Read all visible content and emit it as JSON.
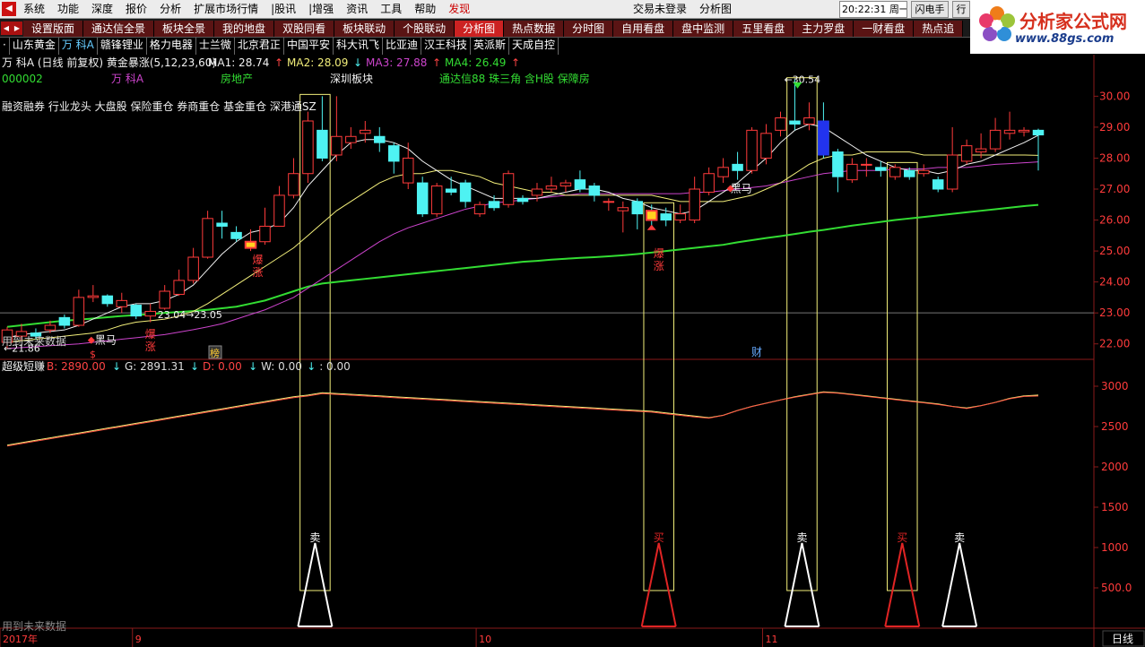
{
  "menu": {
    "items": [
      "系统",
      "功能",
      "深度",
      "报价",
      "分析",
      "扩展市场行情",
      "|股讯",
      "|增强",
      "资讯",
      "工具",
      "帮助",
      "发现"
    ],
    "hot_index": 11,
    "login": "交易未登录",
    "title": "分析图",
    "clock": "20:22:31 周一",
    "flash_button": "闪电手",
    "row_button": "行"
  },
  "logo": {
    "title": "分析家公式网",
    "url": "www.88gs.com"
  },
  "tabs": {
    "items": [
      "设置版面",
      "通达信全景",
      "板块全景",
      "我的地盘",
      "双股同看",
      "板块联动",
      "个股联动",
      "分析图",
      "热点数据",
      "分时图",
      "自用看盘",
      "盘中监测",
      "五里看盘",
      "主力罗盘",
      "一财看盘",
      "热点追"
    ],
    "active_index": 7
  },
  "stocks": {
    "items": [
      "·",
      "山东黄金",
      "万 科A",
      "赣锋锂业",
      "格力电器",
      "士兰微",
      "北京君正",
      "中国平安",
      "科大讯飞",
      "比亚迪",
      "汉王科技",
      "英派斯",
      "天成自控"
    ],
    "selected_index": 2
  },
  "colors": {
    "up": "#ff3b3b",
    "down": "#4ef2f2",
    "ma1": "#f2f2f2",
    "ma2": "#f2ee7a",
    "ma3": "#cc44cc",
    "ma4": "#33dd33",
    "box": "#f2ee7a",
    "b_line": "#ff5544",
    "g_line": "#f2ee7a"
  },
  "main_panel": {
    "title": "万 科A (日线 前复权) 黄金暴涨(5,12,23,60)",
    "ma_legend": [
      {
        "label": "MA1: 28.74",
        "arrow": "↑",
        "arrow_color": "#ff4444",
        "color": "#f2f2f2"
      },
      {
        "label": "MA2: 28.09",
        "arrow": "↓",
        "arrow_color": "#4ef2f2",
        "color": "#f2ee7a"
      },
      {
        "label": "MA3: 27.88",
        "arrow": "↑",
        "arrow_color": "#ff4444",
        "color": "#cc44cc"
      },
      {
        "label": "MA4: 26.49",
        "arrow": "↑",
        "arrow_color": "#ff4444",
        "color": "#33dd33"
      }
    ],
    "code": "000002",
    "name": "万 科A",
    "industry": "房地产",
    "board": "深圳板块",
    "concepts": "通达信88 珠三角 含H股 保障房",
    "tags": "融资融券 行业龙头 大盘股 保险重仓 券商重仓 基金重仓 深港通SZ",
    "future_data_note": "用到未来数据",
    "high_label": "30.54",
    "low_label": "21.86",
    "mid_label": "23.04→23.05",
    "markers": {
      "baozhang": "爆涨",
      "heima": "黑马",
      "s": "$",
      "bang": "榜",
      "cai": "财"
    },
    "y_ticks": [
      "30.00",
      "29.00",
      "28.00",
      "27.00",
      "26.00",
      "25.00",
      "24.00",
      "23.00",
      "22.00"
    ]
  },
  "sub_panel": {
    "title": "超级短赚",
    "legend": [
      {
        "label": "B: 2890.00",
        "arrow": "↓",
        "color": "#ff4444",
        "arrow_color": "#4ef2f2"
      },
      {
        "label": "G: 2891.31",
        "arrow": "↓",
        "color": "#dddddd",
        "arrow_color": "#4ef2f2"
      },
      {
        "label": "D: 0.00",
        "arrow": "↓",
        "color": "#ff4444",
        "arrow_color": "#4ef2f2"
      },
      {
        "label": "W: 0.00",
        "arrow": "↓",
        "color": "#dddddd",
        "arrow_color": "#4ef2f2"
      },
      {
        "label": ": 0.00",
        "arrow": "",
        "color": "#dddddd",
        "arrow_color": "#dddddd"
      }
    ],
    "future_data_note": "用到未来数据",
    "y_ticks": [
      "3000",
      "2500",
      "2000",
      "1500",
      "1000",
      "500.0"
    ],
    "sell_label": "卖",
    "buy_label": "买"
  },
  "x_axis": {
    "labels": [
      "2017年",
      "9",
      "10",
      "11"
    ],
    "period": "日线"
  },
  "chart_data": {
    "type": "candlestick",
    "ylim": [
      21.5,
      30.3
    ],
    "candles": [
      {
        "o": 22.05,
        "c": 22.45,
        "h": 22.55,
        "l": 21.86
      },
      {
        "o": 22.25,
        "c": 22.4,
        "h": 22.65,
        "l": 22.1
      },
      {
        "o": 22.35,
        "c": 22.25,
        "h": 22.5,
        "l": 22.15
      },
      {
        "o": 22.45,
        "c": 22.6,
        "h": 22.75,
        "l": 22.35
      },
      {
        "o": 22.85,
        "c": 22.6,
        "h": 22.95,
        "l": 22.5
      },
      {
        "o": 22.6,
        "c": 23.5,
        "h": 23.75,
        "l": 22.55
      },
      {
        "o": 23.5,
        "c": 23.55,
        "h": 23.9,
        "l": 23.35
      },
      {
        "o": 23.55,
        "c": 23.3,
        "h": 23.6,
        "l": 23.2
      },
      {
        "o": 23.2,
        "c": 23.4,
        "h": 23.65,
        "l": 23.0
      },
      {
        "o": 23.25,
        "c": 22.9,
        "h": 23.3,
        "l": 22.8
      },
      {
        "o": 22.9,
        "c": 23.05,
        "h": 23.3,
        "l": 22.7
      },
      {
        "o": 23.15,
        "c": 23.7,
        "h": 23.9,
        "l": 23.1
      },
      {
        "o": 23.6,
        "c": 24.05,
        "h": 24.4,
        "l": 23.55
      },
      {
        "o": 24.05,
        "c": 24.8,
        "h": 25.1,
        "l": 23.95
      },
      {
        "o": 24.8,
        "c": 26.05,
        "h": 26.3,
        "l": 24.75
      },
      {
        "o": 25.9,
        "c": 25.8,
        "h": 26.3,
        "l": 25.4
      },
      {
        "o": 25.6,
        "c": 25.4,
        "h": 25.8,
        "l": 25.3
      },
      {
        "o": 25.1,
        "c": 25.3,
        "h": 25.7,
        "l": 25.0
      },
      {
        "o": 25.3,
        "c": 25.8,
        "h": 26.4,
        "l": 25.2
      },
      {
        "o": 25.8,
        "c": 26.8,
        "h": 27.1,
        "l": 25.8
      },
      {
        "o": 26.8,
        "c": 27.5,
        "h": 28.0,
        "l": 26.7
      },
      {
        "o": 27.5,
        "c": 29.2,
        "h": 29.5,
        "l": 27.2
      },
      {
        "o": 28.9,
        "c": 28.0,
        "h": 30.0,
        "l": 27.9
      },
      {
        "o": 28.1,
        "c": 28.7,
        "h": 30.0,
        "l": 27.9
      },
      {
        "o": 28.5,
        "c": 28.7,
        "h": 29.0,
        "l": 28.3
      },
      {
        "o": 28.8,
        "c": 28.9,
        "h": 29.2,
        "l": 28.5
      },
      {
        "o": 28.7,
        "c": 28.5,
        "h": 29.0,
        "l": 28.2
      },
      {
        "o": 28.4,
        "c": 27.9,
        "h": 28.5,
        "l": 27.5
      },
      {
        "o": 27.2,
        "c": 28.0,
        "h": 28.5,
        "l": 27.0
      },
      {
        "o": 27.2,
        "c": 26.2,
        "h": 27.4,
        "l": 26.1
      },
      {
        "o": 26.2,
        "c": 27.1,
        "h": 27.2,
        "l": 26.1
      },
      {
        "o": 27.0,
        "c": 26.9,
        "h": 27.4,
        "l": 26.8
      },
      {
        "o": 27.2,
        "c": 26.6,
        "h": 27.3,
        "l": 26.4
      },
      {
        "o": 26.2,
        "c": 26.5,
        "h": 26.6,
        "l": 26.1
      },
      {
        "o": 26.6,
        "c": 26.4,
        "h": 26.8,
        "l": 26.3
      },
      {
        "o": 26.5,
        "c": 27.5,
        "h": 27.6,
        "l": 26.4
      },
      {
        "o": 26.7,
        "c": 26.6,
        "h": 26.8,
        "l": 26.5
      },
      {
        "o": 26.8,
        "c": 27.0,
        "h": 27.2,
        "l": 26.6
      },
      {
        "o": 27.0,
        "c": 27.1,
        "h": 27.4,
        "l": 26.9
      },
      {
        "o": 27.1,
        "c": 27.2,
        "h": 27.3,
        "l": 26.9
      },
      {
        "o": 27.3,
        "c": 27.0,
        "h": 27.6,
        "l": 26.9
      },
      {
        "o": 27.1,
        "c": 26.8,
        "h": 27.2,
        "l": 26.6
      },
      {
        "o": 26.6,
        "c": 26.6,
        "h": 26.7,
        "l": 26.3
      },
      {
        "o": 26.3,
        "c": 26.4,
        "h": 26.6,
        "l": 25.6
      },
      {
        "o": 26.6,
        "c": 26.2,
        "h": 26.7,
        "l": 25.7
      },
      {
        "o": 26.3,
        "c": 26.0,
        "h": 26.5,
        "l": 25.8
      },
      {
        "o": 26.2,
        "c": 26.0,
        "h": 26.4,
        "l": 25.8
      },
      {
        "o": 26.0,
        "c": 26.2,
        "h": 26.5,
        "l": 25.9
      },
      {
        "o": 26.0,
        "c": 27.0,
        "h": 27.4,
        "l": 25.9
      },
      {
        "o": 26.9,
        "c": 27.5,
        "h": 27.7,
        "l": 26.8
      },
      {
        "o": 27.4,
        "c": 27.7,
        "h": 28.0,
        "l": 27.2
      },
      {
        "o": 27.8,
        "c": 27.6,
        "h": 28.2,
        "l": 27.3
      },
      {
        "o": 27.6,
        "c": 28.9,
        "h": 29.0,
        "l": 27.5
      },
      {
        "o": 28.0,
        "c": 28.8,
        "h": 29.1,
        "l": 27.8
      },
      {
        "o": 28.9,
        "c": 29.3,
        "h": 29.5,
        "l": 28.7
      },
      {
        "o": 29.2,
        "c": 29.1,
        "h": 30.54,
        "l": 28.9
      },
      {
        "o": 29.1,
        "c": 29.3,
        "h": 29.8,
        "l": 28.9
      },
      {
        "o": 29.2,
        "c": 28.1,
        "h": 29.8,
        "l": 28.0
      },
      {
        "o": 28.2,
        "c": 27.4,
        "h": 28.3,
        "l": 26.9
      },
      {
        "o": 27.3,
        "c": 27.8,
        "h": 28.0,
        "l": 27.2
      },
      {
        "o": 27.8,
        "c": 27.8,
        "h": 28.0,
        "l": 27.4
      },
      {
        "o": 27.7,
        "c": 27.6,
        "h": 27.9,
        "l": 27.4
      },
      {
        "o": 27.4,
        "c": 27.7,
        "h": 27.8,
        "l": 27.3
      },
      {
        "o": 27.6,
        "c": 27.4,
        "h": 27.7,
        "l": 27.3
      },
      {
        "o": 27.5,
        "c": 27.6,
        "h": 27.8,
        "l": 27.4
      },
      {
        "o": 27.3,
        "c": 27.0,
        "h": 27.4,
        "l": 26.9
      },
      {
        "o": 27.0,
        "c": 28.1,
        "h": 29.0,
        "l": 26.9
      },
      {
        "o": 27.9,
        "c": 28.4,
        "h": 28.6,
        "l": 27.8
      },
      {
        "o": 28.2,
        "c": 28.3,
        "h": 28.8,
        "l": 28.0
      },
      {
        "o": 28.3,
        "c": 28.9,
        "h": 29.3,
        "l": 28.2
      },
      {
        "o": 28.8,
        "c": 28.9,
        "h": 29.5,
        "l": 28.6
      },
      {
        "o": 28.85,
        "c": 28.9,
        "h": 29.0,
        "l": 28.7
      },
      {
        "o": 28.9,
        "c": 28.75,
        "h": 28.95,
        "l": 27.6
      }
    ],
    "ma": {
      "ma1": [
        22.2,
        22.3,
        22.35,
        22.4,
        22.45,
        22.6,
        22.8,
        23.0,
        23.2,
        23.3,
        23.3,
        23.4,
        23.6,
        23.9,
        24.4,
        24.9,
        25.3,
        25.6,
        25.7,
        25.9,
        26.4,
        27.1,
        27.6,
        28.1,
        28.5,
        28.6,
        28.6,
        28.5,
        28.3,
        27.9,
        27.6,
        27.3,
        27.1,
        26.9,
        26.7,
        26.7,
        26.7,
        26.7,
        26.8,
        26.9,
        27.0,
        27.0,
        26.9,
        26.7,
        26.6,
        26.4,
        26.3,
        26.2,
        26.3,
        26.6,
        26.9,
        27.2,
        27.6,
        28.0,
        28.5,
        28.9,
        29.1,
        29.0,
        28.7,
        28.4,
        28.1,
        27.9,
        27.7,
        27.6,
        27.6,
        27.5,
        27.6,
        27.8,
        27.9,
        28.1,
        28.3,
        28.5,
        28.74
      ],
      "ma2": [
        22.05,
        22.1,
        22.15,
        22.2,
        22.25,
        22.3,
        22.35,
        22.45,
        22.6,
        22.7,
        22.75,
        22.8,
        22.9,
        23.05,
        23.3,
        23.6,
        23.9,
        24.2,
        24.5,
        24.8,
        25.1,
        25.5,
        25.9,
        26.3,
        26.6,
        26.9,
        27.2,
        27.4,
        27.5,
        27.5,
        27.6,
        27.6,
        27.5,
        27.4,
        27.2,
        27.1,
        27.0,
        26.9,
        26.9,
        26.8,
        26.8,
        26.8,
        26.8,
        26.8,
        26.8,
        26.8,
        26.7,
        26.6,
        26.6,
        26.6,
        26.6,
        26.7,
        26.8,
        27.0,
        27.2,
        27.5,
        27.8,
        28.0,
        28.1,
        28.1,
        28.2,
        28.2,
        28.2,
        28.2,
        28.1,
        28.1,
        28.1,
        28.1,
        28.1,
        28.1,
        28.1,
        28.1,
        28.09
      ],
      "ma3": [
        21.85,
        21.88,
        21.91,
        21.94,
        21.97,
        22.0,
        22.05,
        22.1,
        22.15,
        22.2,
        22.25,
        22.3,
        22.38,
        22.46,
        22.55,
        22.65,
        22.8,
        22.95,
        23.1,
        23.3,
        23.5,
        23.8,
        24.1,
        24.4,
        24.7,
        25.0,
        25.3,
        25.55,
        25.75,
        25.9,
        26.05,
        26.2,
        26.35,
        26.45,
        26.55,
        26.6,
        26.65,
        26.7,
        26.75,
        26.8,
        26.85,
        26.85,
        26.85,
        26.85,
        26.85,
        26.85,
        26.85,
        26.85,
        26.9,
        26.9,
        26.95,
        27.0,
        27.05,
        27.1,
        27.2,
        27.3,
        27.4,
        27.5,
        27.55,
        27.6,
        27.6,
        27.6,
        27.65,
        27.65,
        27.65,
        27.7,
        27.7,
        27.7,
        27.75,
        27.8,
        27.82,
        27.85,
        27.88
      ],
      "ma4": [
        22.55,
        22.6,
        22.65,
        22.7,
        22.75,
        22.78,
        22.82,
        22.86,
        22.9,
        22.93,
        22.96,
        23.0,
        23.03,
        23.06,
        23.1,
        23.15,
        23.2,
        23.3,
        23.4,
        23.55,
        23.7,
        23.85,
        23.95,
        24.0,
        24.05,
        24.1,
        24.15,
        24.2,
        24.25,
        24.3,
        24.35,
        24.4,
        24.45,
        24.5,
        24.55,
        24.6,
        24.65,
        24.68,
        24.72,
        24.75,
        24.78,
        24.8,
        24.83,
        24.86,
        24.9,
        24.95,
        25.0,
        25.05,
        25.1,
        25.15,
        25.2,
        25.28,
        25.35,
        25.42,
        25.48,
        25.55,
        25.62,
        25.68,
        25.75,
        25.82,
        25.88,
        25.94,
        26.0,
        26.05,
        26.1,
        26.15,
        26.2,
        26.25,
        26.3,
        26.35,
        26.4,
        26.45,
        26.49
      ]
    },
    "sub_lines": {
      "ylim": [
        0,
        3200
      ],
      "g": [
        2270,
        2300,
        2330,
        2360,
        2390,
        2420,
        2450,
        2480,
        2510,
        2540,
        2570,
        2600,
        2630,
        2660,
        2690,
        2720,
        2750,
        2780,
        2810,
        2840,
        2870,
        2890,
        2920,
        2910,
        2900,
        2890,
        2880,
        2870,
        2860,
        2850,
        2840,
        2830,
        2820,
        2810,
        2800,
        2790,
        2780,
        2770,
        2760,
        2750,
        2740,
        2730,
        2720,
        2710,
        2700,
        2690,
        2670,
        2650,
        2630,
        2610,
        2640,
        2700,
        2750,
        2790,
        2830,
        2870,
        2900,
        2930,
        2920,
        2900,
        2880,
        2860,
        2840,
        2820,
        2800,
        2780,
        2750,
        2730,
        2760,
        2800,
        2850,
        2880,
        2890
      ],
      "b": [
        2270,
        2300,
        2330,
        2360,
        2390,
        2420,
        2450,
        2480,
        2510,
        2540,
        2570,
        2600,
        2630,
        2660,
        2690,
        2720,
        2750,
        2780,
        2810,
        2840,
        2870,
        2890,
        2920,
        2910,
        2900,
        2890,
        2880,
        2870,
        2860,
        2850,
        2840,
        2830,
        2820,
        2810,
        2800,
        2790,
        2780,
        2770,
        2760,
        2750,
        2740,
        2730,
        2720,
        2710,
        2700,
        2690,
        2670,
        2650,
        2630,
        2615,
        2650,
        2710,
        2760,
        2800,
        2840,
        2875,
        2905,
        2935,
        2925,
        2905,
        2885,
        2865,
        2845,
        2825,
        2805,
        2785,
        2760,
        2735,
        2770,
        2810,
        2855,
        2885,
        2890
      ]
    },
    "signal_boxes": [
      {
        "start": 21,
        "end": 22
      },
      {
        "start": 45,
        "end": 46
      },
      {
        "start": 55,
        "end": 56
      },
      {
        "start": 62,
        "end": 63
      }
    ],
    "triangles": [
      {
        "index": 21,
        "type": "sell",
        "color": "#ffffff"
      },
      {
        "index": 45,
        "type": "buy",
        "color": "#e02424"
      },
      {
        "index": 55,
        "type": "sell",
        "color": "#ffffff"
      },
      {
        "index": 62,
        "type": "buy",
        "color": "#e02424"
      },
      {
        "index": 66,
        "type": "sell",
        "color": "#ffffff"
      }
    ],
    "x_label_positions": [
      0,
      9,
      33,
      53
    ]
  }
}
